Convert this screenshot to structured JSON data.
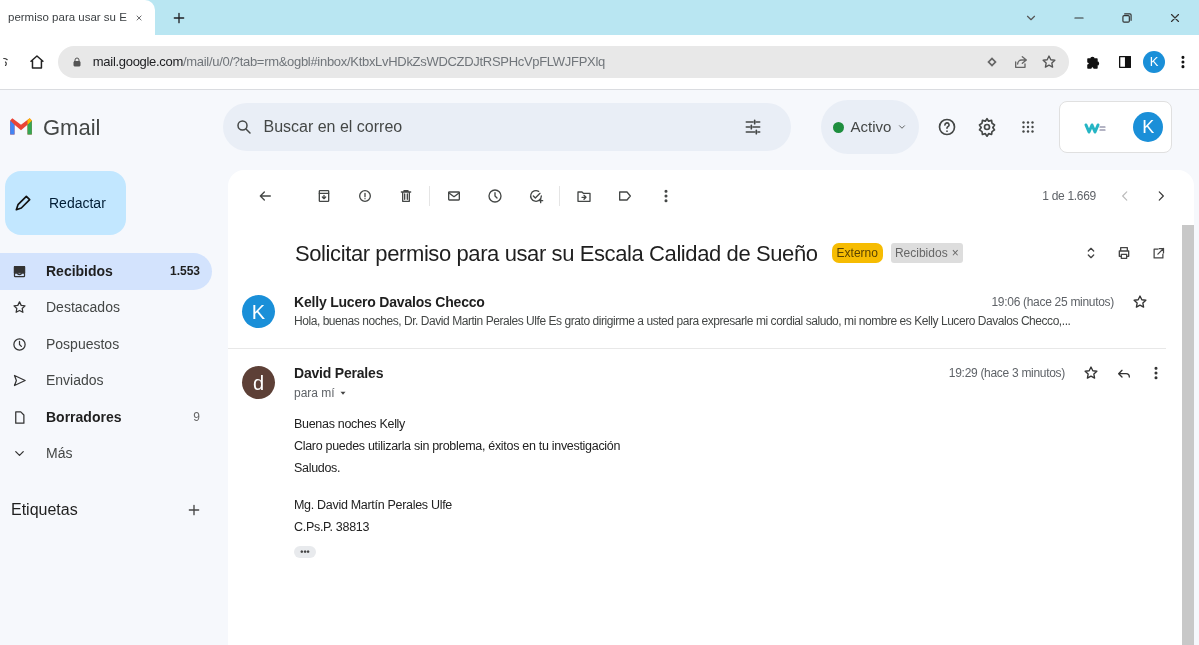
{
  "browser": {
    "tab": {
      "title": "permiso para usar su E"
    },
    "url_host": "mail.google.com",
    "url_path": "/mail/u/0/?tab=rm&ogbl#inbox/KtbxLvHDkZsWDCZDJtRSPHcVpFLWJFPXlq",
    "profile_letter": "K"
  },
  "header": {
    "app_name": "Gmail",
    "search": {
      "placeholder": "Buscar en el correo"
    },
    "status": {
      "label": "Activo",
      "color": "#1e8e3e"
    },
    "account_letter": "K"
  },
  "compose": "Redactar",
  "nav": [
    {
      "label": "Recibidos",
      "count": "1.553",
      "selected": true,
      "bold": true
    },
    {
      "label": "Destacados",
      "selected": false,
      "bold": false
    },
    {
      "label": "Pospuestos",
      "selected": false,
      "bold": false
    },
    {
      "label": "Enviados",
      "selected": false,
      "bold": false
    },
    {
      "label": "Borradores",
      "count": "9",
      "selected": false,
      "bold": true
    },
    {
      "label": "Más",
      "selected": false,
      "bold": false
    }
  ],
  "labels_heading": "Etiquetas",
  "pager": "1 de 1.669",
  "subject": "Solicitar permiso para usar su Escala Calidad de Sueño",
  "tags": [
    {
      "text": "Externo",
      "kind": "external"
    },
    {
      "text": "Recibidos",
      "kind": "label",
      "remove": "×"
    }
  ],
  "messages": [
    {
      "sender": "Kelly Lucero Davalos Checco",
      "avatar": "K",
      "color": "#1a8fd8",
      "time": "19:06 (hace 25 minutos)",
      "starred": false,
      "expanded": false,
      "preview": "Hola, buenas noches, Dr. David Martin Perales Ulfe Es grato dirigirme a usted para expresarle mi cordial saludo, mi nombre es Kelly Lucero Davalos Checco,..."
    },
    {
      "sender": "David Perales",
      "avatar": "d",
      "color": "#5d4037",
      "time": "19:29 (hace 3 minutos)",
      "starred": false,
      "expanded": true,
      "to": "para mí",
      "trimmed": "•••",
      "paragraphs": [
        [
          "Buenas noches Kelly",
          "Claro puedes utilizarla sin problema, éxitos en tu investigación",
          "Saludos."
        ],
        [
          "Mg. David Martín Perales Ulfe",
          "C.Ps.P. 38813"
        ]
      ]
    }
  ]
}
